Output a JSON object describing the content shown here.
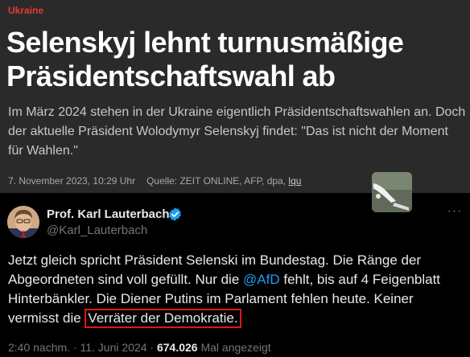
{
  "article": {
    "kicker": "Ukraine",
    "headline": "Selenskyj lehnt turnusmäßige Präsidentschaftswahl ab",
    "teaser": "Im März 2024 stehen in der Ukraine eigentlich Präsidentschaftswahlen an. Doch der aktuelle Präsident Wolodymyr Selenskyj findet: \"Das ist nicht der Moment für Wahlen.\"",
    "date": "7. November 2023, 10:29 Uhr",
    "source": "Quelle: ZEIT ONLINE, AFP, dpa,",
    "author_link": "lqu",
    "colors": {
      "kicker": "#e5393b",
      "background": "#2a2a2a"
    }
  },
  "tweet": {
    "display_name": "Prof. Karl Lauterbach",
    "handle": "@Karl_Lauterbach",
    "verified_icon": "verified-badge-icon",
    "more_icon": "more-options-icon",
    "text_before_mention": "Jetzt gleich spricht Präsident Selenski im Bundestag. Die Ränge der Abgeordneten sind voll gefüllt. Nur die ",
    "mention": "@AfD",
    "text_after_mention": " fehlt, bis auf 4 Feigenblatt Hinterbänkler. Die Diener Putins im Parlament fehlen heute. Keiner vermisst die ",
    "highlighted_text": "Verräter der Demokratie.",
    "timestamp": "2:40 nachm. · 11. Juni 2024 ·",
    "views_count": "674.026",
    "views_label": "Mal angezeigt",
    "colors": {
      "mention": "#1d9bf0",
      "highlight_border": "#e3141a",
      "verified": "#1d9bf0"
    }
  }
}
